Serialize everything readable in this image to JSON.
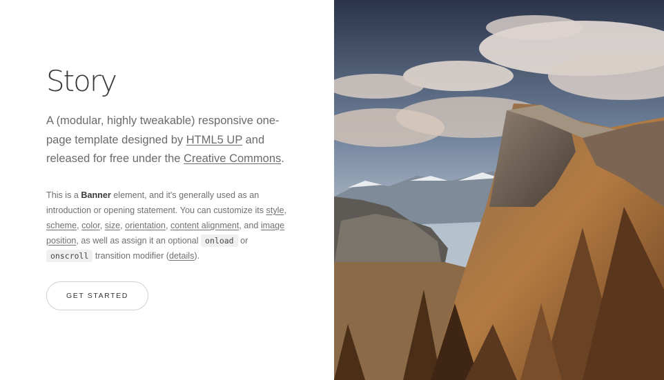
{
  "banner": {
    "title": "Story",
    "major": {
      "t1": "A (modular, highly tweakable) responsive one-page template designed by ",
      "link1": "HTML5 UP",
      "t2": " and released for free under the ",
      "link2": "Creative Commons",
      "t3": "."
    },
    "minor": {
      "t1": "This is a ",
      "strong": "Banner",
      "t2": " element, and it's generally used as an introduction or opening statement. You can customize its ",
      "link_style": "style",
      "t3": ", ",
      "link_scheme": "scheme",
      "t4": ", ",
      "link_color": "color",
      "t5": ", ",
      "link_size": "size",
      "t6": ", ",
      "link_orientation": "orientation",
      "t7": ", ",
      "link_content_alignment": "content alignment",
      "t8": ", and ",
      "link_image_position": "image position",
      "t9": ", as well as assign it an optional ",
      "code_onload": "onload",
      "t10": " or ",
      "code_onscroll": "onscroll",
      "t11": " transition modifier (",
      "link_details": "details",
      "t12": ")."
    },
    "button_label": "GET STARTED"
  },
  "image": {
    "icon": "mountain-landscape-photo",
    "colors": {
      "sky_top": "#2f3a52",
      "sky_bottom": "#a9b6c5",
      "cloud": "#efe7e1",
      "rock": "#6b5a4c",
      "slope": "#9a6a3a",
      "grass": "#c78a4a",
      "trees": "#4a2e18"
    }
  }
}
